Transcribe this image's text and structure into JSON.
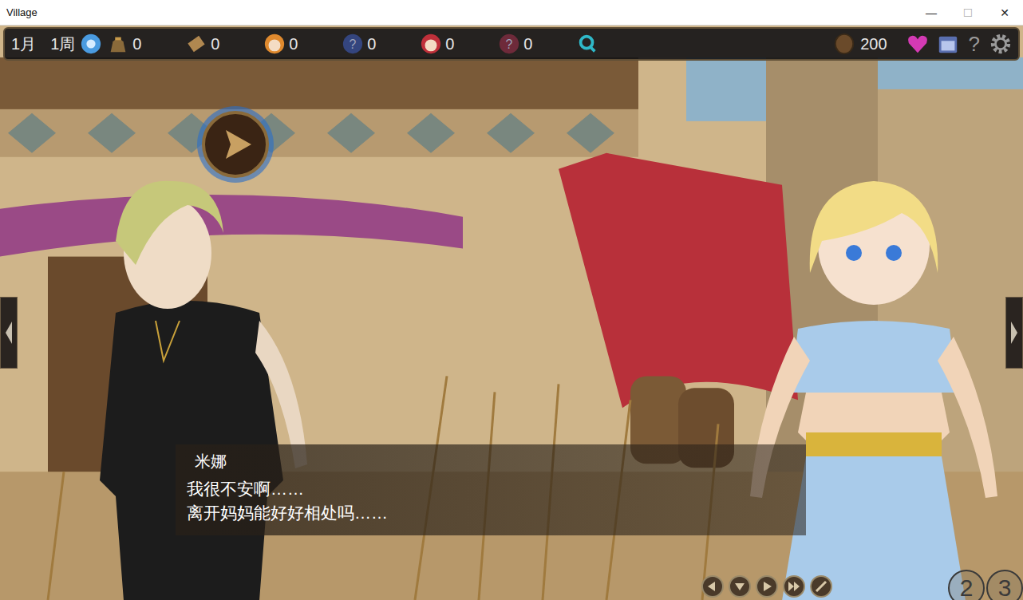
{
  "window": {
    "title": "Village",
    "buttons": [
      {
        "label": "—",
        "disabled": false
      },
      {
        "label": "☐",
        "disabled": true
      },
      {
        "label": "✕",
        "disabled": false
      }
    ]
  },
  "hud": {
    "month": "1月",
    "week": "1周",
    "counters": [
      {
        "kind": "bag",
        "value": "0"
      },
      {
        "kind": "scroll",
        "value": "0"
      },
      {
        "kind": "face",
        "value": "0",
        "color": "#e08a2e"
      },
      {
        "kind": "unknown",
        "value": "0",
        "glyph": "?",
        "color": "#34457e"
      },
      {
        "kind": "face",
        "value": "0",
        "color": "#c0303a"
      },
      {
        "kind": "unknown",
        "value": "0",
        "glyph": "?",
        "color": "#6e2a3a"
      }
    ],
    "money": "200",
    "help": "?"
  },
  "dialogue": {
    "speaker": "米娜",
    "lines": [
      "我很不安啊……",
      "离开妈妈能好好相处吗……"
    ]
  },
  "controls": [
    {
      "kind": "back"
    },
    {
      "kind": "log"
    },
    {
      "kind": "play"
    },
    {
      "kind": "skip"
    },
    {
      "kind": "hide"
    }
  ],
  "pages": [
    {
      "label": "2",
      "selected": false
    },
    {
      "label": "3",
      "selected": false
    }
  ]
}
